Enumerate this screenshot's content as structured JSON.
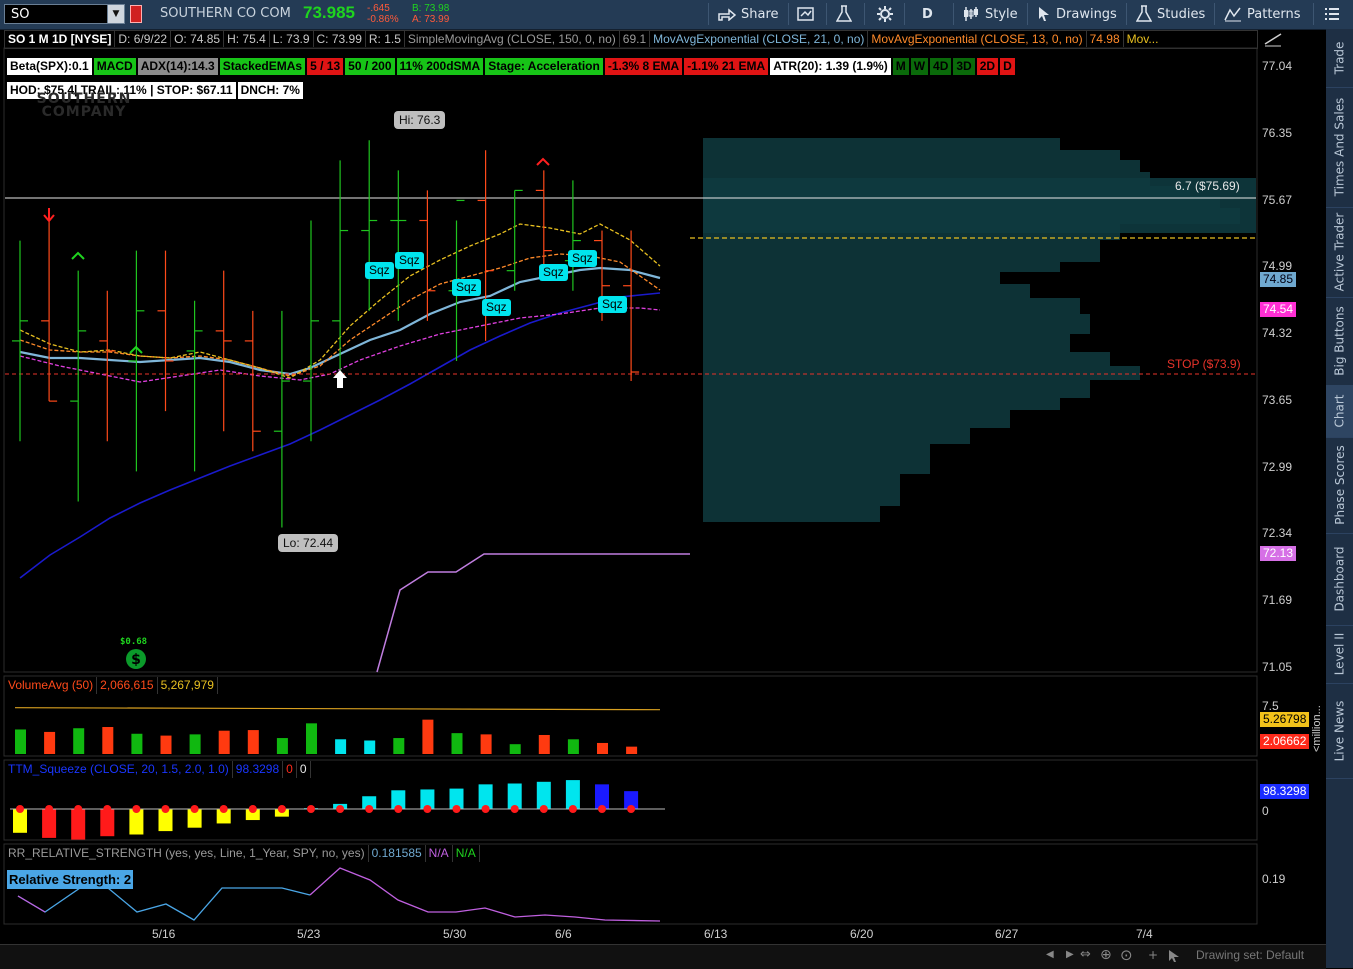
{
  "toolbar": {
    "symbol": "SO",
    "company": "SOUTHERN CO COM",
    "last_price": "73.985",
    "net_change": "-.645",
    "pct_change": "-0.86%",
    "bid": "B: 73.98",
    "ask": "A: 73.99",
    "share_label": "Share",
    "period_label": "D",
    "style_label": "Style",
    "drawings_label": "Drawings",
    "studies_label": "Studies",
    "patterns_label": "Patterns"
  },
  "header_row1": {
    "title": "SO 1 M 1D [NYSE]",
    "date": "D: 6/9/22",
    "open": "O: 74.85",
    "high": "H: 75.4",
    "low": "L: 73.9",
    "close": "C: 73.99",
    "range": "R: 1.5",
    "sma_label": "SimpleMovingAvg (CLOSE, 150, 0, no)",
    "sma_value": "69.1",
    "ema21_label": "MovAvgExponential (CLOSE, 21, 0, no)",
    "ema13_label": "MovAvgExponential (CLOSE, 13, 0, no)",
    "ema13_value": "74.98",
    "more_label": "Mov..."
  },
  "chips": [
    {
      "text": "Beta(SPX):0.1",
      "bg": "#ffffff",
      "fg": "#000000"
    },
    {
      "text": "MACD",
      "bg": "#17c417",
      "fg": "#000000"
    },
    {
      "text": "ADX(14):14.3",
      "bg": "#8c8c8c",
      "fg": "#000000"
    },
    {
      "text": "StackedEMAs",
      "bg": "#17c417",
      "fg": "#000000"
    },
    {
      "text": "5 / 13",
      "bg": "#e01414",
      "fg": "#000000"
    },
    {
      "text": "50 / 200",
      "bg": "#17c417",
      "fg": "#000000"
    },
    {
      "text": "11% 200dSMA",
      "bg": "#17c417",
      "fg": "#000000"
    },
    {
      "text": "Stage: Acceleration",
      "bg": "#17c417",
      "fg": "#000000"
    },
    {
      "text": "-1.3% 8 EMA",
      "bg": "#e01414",
      "fg": "#000000"
    },
    {
      "text": "-1.1% 21 EMA",
      "bg": "#e01414",
      "fg": "#000000"
    },
    {
      "text": "ATR(20): 1.39 (1.9%)",
      "bg": "#ffffff",
      "fg": "#000000"
    },
    {
      "text": "M",
      "bg": "#0a6a0a",
      "fg": "#000000"
    },
    {
      "text": "W",
      "bg": "#0a6a0a",
      "fg": "#000000"
    },
    {
      "text": "4D",
      "bg": "#0a6a0a",
      "fg": "#000000"
    },
    {
      "text": "3D",
      "bg": "#0a6a0a",
      "fg": "#000000"
    },
    {
      "text": "2D",
      "bg": "#e01414",
      "fg": "#000000"
    },
    {
      "text": "D",
      "bg": "#e01414",
      "fg": "#000000"
    }
  ],
  "chips_row2": {
    "text": "HOD: $75.4| TRAIL: 11% | STOP: $67.11",
    "dnch": "DNCH: 7%"
  },
  "watermark": "SOUTHERN COMPANY",
  "price_axis": {
    "ticks": [
      "77.04",
      "76.35",
      "75.67",
      "74.99",
      "74.32",
      "73.65",
      "72.99",
      "72.34",
      "71.69",
      "71.05"
    ],
    "tag_last": "74.85",
    "tag_ema": "74.54",
    "tag_low": "72.13"
  },
  "annotations": {
    "hi": "Hi: 76.3",
    "lo": "Lo: 72.44",
    "fib": "6.7 ($75.69)",
    "stop": "STOP ($73.9)",
    "dividend": "$0.68",
    "squeeze": "Sqz"
  },
  "volume_panel": {
    "label": "VolumeAvg (50)",
    "volume": "2,066,615",
    "avg": "5,267,979",
    "axis_top": "7.5",
    "tag_avg": "5.26798",
    "tag_vol": "2.06662",
    "unit": "<million..."
  },
  "squeeze_panel": {
    "label": "TTM_Squeeze (CLOSE, 20, 1.5, 2.0, 1.0)",
    "value": "98.3298",
    "v2": "0",
    "v3": "0",
    "tag": "98.3298",
    "zero": "0"
  },
  "rs_panel": {
    "label": "RR_RELATIVE_STRENGTH (yes, yes, Line, 1_Year, SPY, no, yes)",
    "value": "0.181585",
    "na1": "N/A",
    "na2": "N/A",
    "badge": "Relative Strength: 2",
    "axis": "0.19"
  },
  "x_axis": [
    "5/16",
    "5/23",
    "5/30",
    "6/6",
    "6/13",
    "6/20",
    "6/27",
    "7/4"
  ],
  "bottom_bar": {
    "drawing_set": "Drawing set: Default"
  },
  "sidebar_tabs": [
    "Trade",
    "Times And Sales",
    "Active Trader",
    "Big Buttons",
    "Chart",
    "Phase Scores",
    "Dashboard",
    "Level II",
    "Live News"
  ],
  "colors": {
    "up": "#1fc41f",
    "down": "#ff4a1a",
    "squeeze": "#00e5ee",
    "ema_blue": "#7fb6d9",
    "sma_navy": "#1a1aff",
    "toolbar": "#243b55"
  },
  "chart_data": {
    "type": "candlestick",
    "period": "1 M 1D",
    "dates": [
      "5/10",
      "5/11",
      "5/12",
      "5/13",
      "5/16",
      "5/17",
      "5/18",
      "5/19",
      "5/20",
      "5/23",
      "5/24",
      "5/25",
      "5/26",
      "5/27",
      "5/31",
      "6/1",
      "6/2",
      "6/3",
      "6/6",
      "6/7",
      "6/8",
      "6/9"
    ],
    "open": [
      74.3,
      74.5,
      73.7,
      74.3,
      74.1,
      74.6,
      74.2,
      74.4,
      74.3,
      73.4,
      73.9,
      74.5,
      75.4,
      75.5,
      75.5,
      74.8,
      75.7,
      75.0,
      75.8,
      75.1,
      75.3,
      74.85
    ],
    "high": [
      75.3,
      75.5,
      75.0,
      74.8,
      75.2,
      75.2,
      74.7,
      75.0,
      74.6,
      74.6,
      75.5,
      76.1,
      76.3,
      76.0,
      75.8,
      75.5,
      76.2,
      75.8,
      76.0,
      75.9,
      75.4,
      75.4
    ],
    "low": [
      73.3,
      73.7,
      72.7,
      73.3,
      73.0,
      73.6,
      73.0,
      73.4,
      73.2,
      72.44,
      73.3,
      74.0,
      74.6,
      74.5,
      74.5,
      74.1,
      74.3,
      74.8,
      74.9,
      74.8,
      74.5,
      73.9
    ],
    "close": [
      74.5,
      73.7,
      74.4,
      74.2,
      74.6,
      74.1,
      74.4,
      74.3,
      73.4,
      73.9,
      74.5,
      75.4,
      75.5,
      75.5,
      74.8,
      75.7,
      75.0,
      75.8,
      75.2,
      75.3,
      74.85,
      73.99
    ],
    "volume_millions": [
      4.0,
      3.6,
      4.2,
      4.4,
      3.3,
      3.0,
      3.2,
      3.8,
      3.9,
      2.6,
      5.0,
      2.4,
      2.2,
      2.6,
      5.6,
      3.4,
      3.2,
      1.6,
      3.1,
      2.4,
      1.8,
      1.2
    ],
    "volume_avg_millions": 5.26798,
    "squeeze_histogram": [
      -2.8,
      -3.4,
      -3.6,
      -3.2,
      -3.0,
      -2.6,
      -2.2,
      -1.7,
      -1.3,
      -0.9,
      0.1,
      0.6,
      1.5,
      2.2,
      2.3,
      2.4,
      2.9,
      3.0,
      3.2,
      3.4,
      2.9,
      2.1
    ],
    "rs_line": [
      0.17,
      0.16,
      0.17,
      0.16,
      0.16,
      0.15,
      0.17,
      0.17,
      0.17,
      0.16,
      0.19,
      0.18,
      0.16,
      0.15,
      0.15,
      0.15,
      0.14,
      0.14,
      0.14,
      0.14,
      0.14,
      0.14
    ],
    "ylim": [
      71.05,
      77.04
    ]
  }
}
